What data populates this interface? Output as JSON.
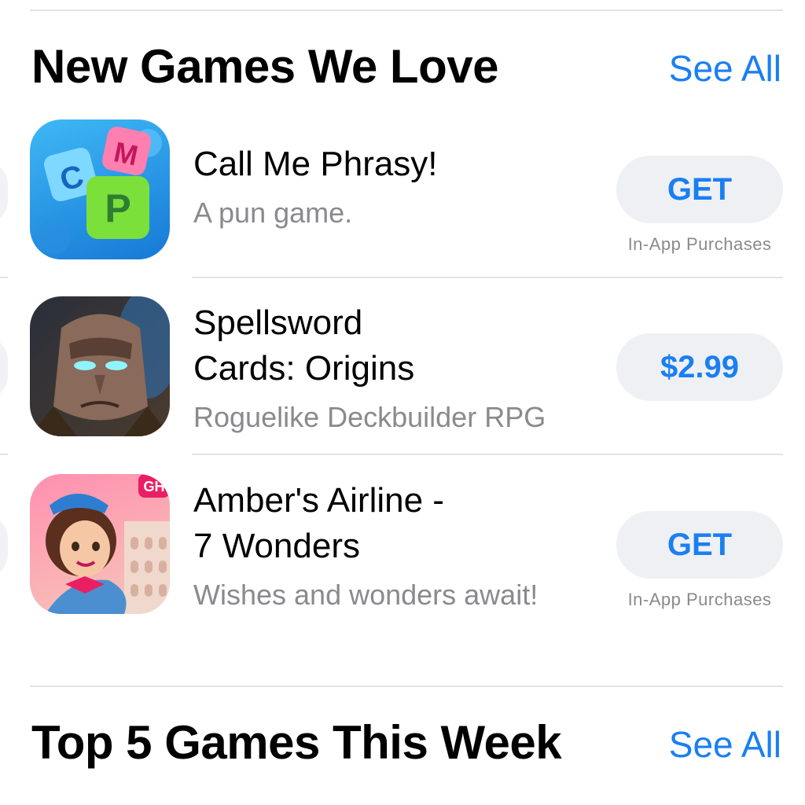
{
  "sections": [
    {
      "title": "New Games We Love",
      "see_all": "See All"
    },
    {
      "title": "Top 5 Games This Week",
      "see_all": "See All"
    }
  ],
  "apps": [
    {
      "name_lines": [
        "Call Me Phrasy!"
      ],
      "subtitle": "A pun game.",
      "button": "GET",
      "note": "In-App Purchases",
      "icon": "word-blocks-icon"
    },
    {
      "name_lines": [
        "Spellsword",
        "Cards: Origins"
      ],
      "subtitle": "Roguelike Deckbuilder RPG",
      "button": "$2.99",
      "note": "",
      "icon": "warrior-face-icon"
    },
    {
      "name_lines": [
        "Amber's Airline -",
        "7 Wonders"
      ],
      "subtitle": "Wishes and wonders await!",
      "button": "GET",
      "note": "In-App Purchases",
      "icon": "stewardess-icon"
    }
  ],
  "icon_text": {
    "tile_c": "C",
    "tile_m": "M",
    "tile_p": "P",
    "badge": "GH"
  },
  "colors": {
    "accent": "#1a7ff2",
    "button_bg": "#eff0f4",
    "secondary_text": "#8a8a8e"
  }
}
